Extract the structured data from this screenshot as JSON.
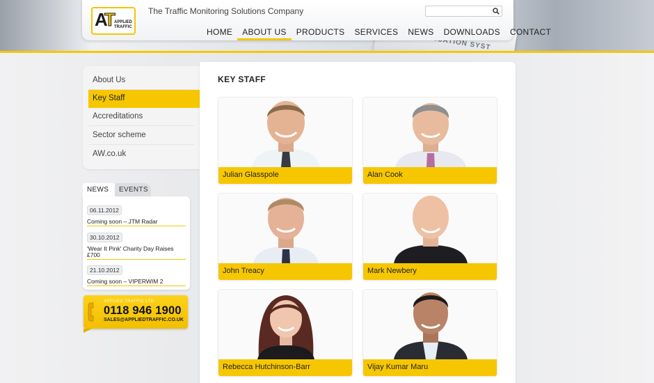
{
  "header": {
    "tagline": "The Traffic Monitoring Solutions Company",
    "logo_text": "APPLIED TRAFFIC",
    "logo_mark": "AT",
    "background_sign_text": "CLASSIFICATION SYST",
    "search": {
      "placeholder": "",
      "icon": "search-icon"
    },
    "nav": [
      {
        "label": "HOME",
        "active": false
      },
      {
        "label": "ABOUT US",
        "active": true
      },
      {
        "label": "PRODUCTS",
        "active": false
      },
      {
        "label": "SERVICES",
        "active": false
      },
      {
        "label": "NEWS",
        "active": false
      },
      {
        "label": "DOWNLOADS",
        "active": false
      },
      {
        "label": "CONTACT",
        "active": false
      }
    ]
  },
  "sidebar": {
    "items": [
      {
        "label": "About Us",
        "active": false
      },
      {
        "label": "Key Staff",
        "active": true
      },
      {
        "label": "Accreditations",
        "active": false
      },
      {
        "label": "Sector scheme",
        "active": false
      },
      {
        "label": "AW.co.uk",
        "active": false
      }
    ]
  },
  "news": {
    "tabs": [
      "NEWS",
      "EVENTS"
    ],
    "entries": [
      {
        "date": "06.11.2012",
        "title": "Coming soon – JTM Radar"
      },
      {
        "date": "30.10.2012",
        "title": "'Wear It Pink' Charity Day Raises £700"
      },
      {
        "date": "21.10.2012",
        "title": "Coming soon – VIPERWIM 2"
      }
    ]
  },
  "contact": {
    "company": "APPLIED TRAFFIC LTD",
    "phone": "0118 946 1900",
    "email": "SALES@APPLIEDTRAFFIC.CO.UK",
    "icon": "phone-icon"
  },
  "main": {
    "title": "KEY STAFF",
    "staff": [
      {
        "name": "Julian Glasspole"
      },
      {
        "name": "Alan Cook"
      },
      {
        "name": "John Treacy"
      },
      {
        "name": "Mark Newbery"
      },
      {
        "name": "Rebecca Hutchinson-Barr"
      },
      {
        "name": "Vijay Kumar Maru"
      }
    ]
  },
  "colors": {
    "accent": "#f6c700",
    "text": "#222222",
    "panel": "#ffffff"
  }
}
